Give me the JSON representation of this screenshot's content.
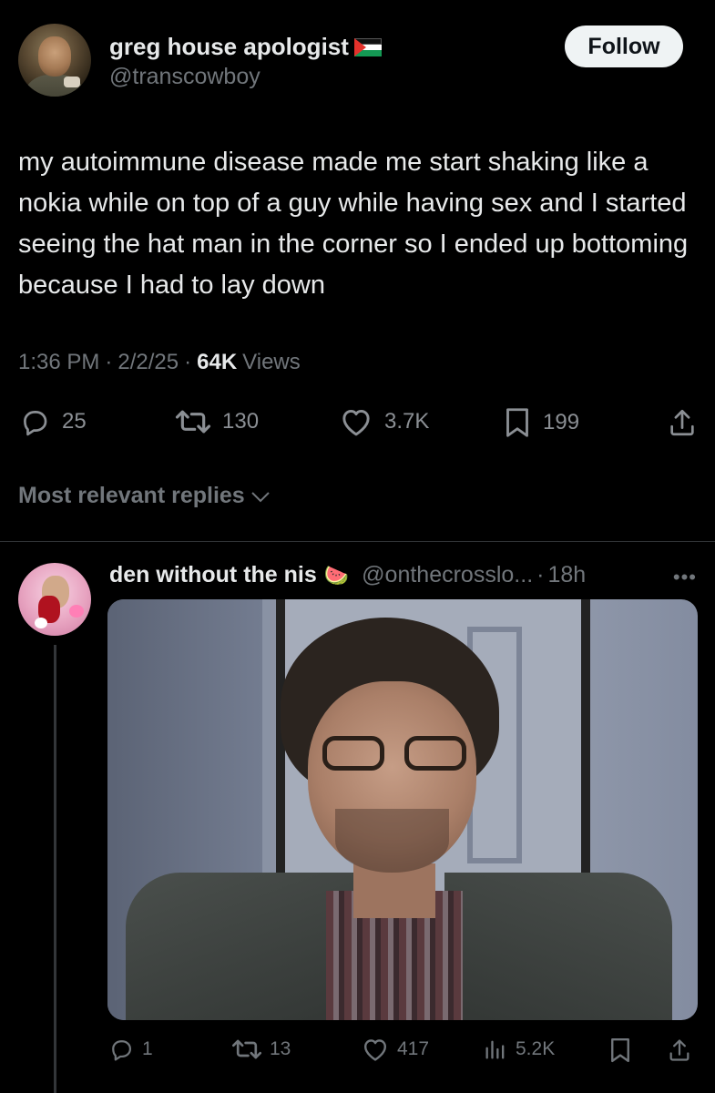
{
  "post": {
    "author": {
      "display_name": "greg house apologist",
      "handle": "@transcowboy",
      "flag_icon": "palestine-flag-icon"
    },
    "follow_label": "Follow",
    "text": "my autoimmune disease made me start shaking like a nokia while on top of a guy while having sex and I started seeing the hat man in the corner so I ended up bottoming because I had to lay down",
    "meta": {
      "time": "1:36 PM",
      "sep1": "·",
      "date": "2/2/25",
      "sep2": "·",
      "views_count": "64K",
      "views_label": "Views"
    },
    "actions": {
      "replies": "25",
      "reposts": "130",
      "likes": "3.7K",
      "bookmarks": "199"
    }
  },
  "replies_sort_label": "Most relevant replies",
  "reply": {
    "display_name": "den without the nis",
    "emoji": "🍉",
    "handle": "@onthecrosslo...",
    "sep": "·",
    "time": "18h",
    "actions": {
      "replies": "1",
      "reposts": "13",
      "likes": "417",
      "views": "5.2K"
    }
  },
  "colors": {
    "background": "#000000",
    "text_primary": "#e7e9ea",
    "text_secondary": "#71767b",
    "follow_bg": "#eff3f4",
    "divider": "#2f3336"
  }
}
